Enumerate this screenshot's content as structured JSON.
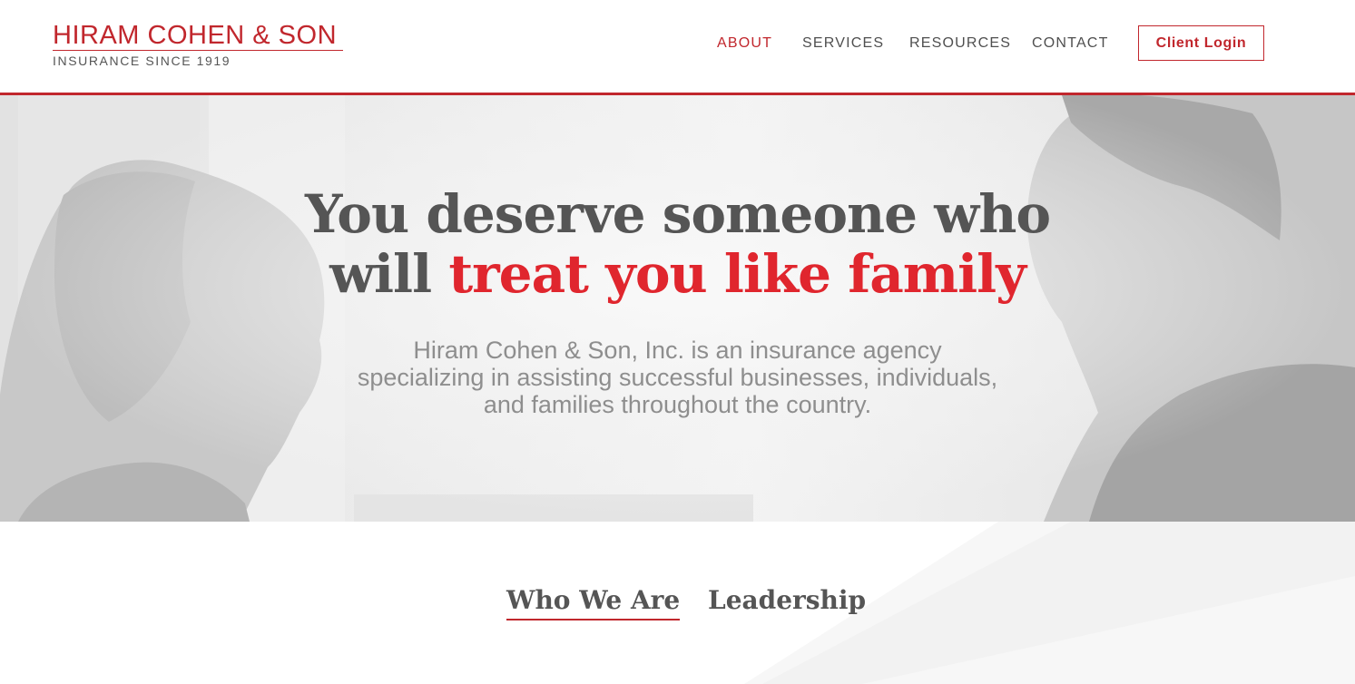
{
  "logo": {
    "title": "HIRAM COHEN & SON",
    "subtitle": "INSURANCE SINCE 1919"
  },
  "nav": {
    "items": [
      {
        "label": "ABOUT",
        "active": true
      },
      {
        "label": "SERVICES",
        "active": false
      },
      {
        "label": "RESOURCES",
        "active": false
      },
      {
        "label": "CONTACT",
        "active": false
      }
    ],
    "login_label": "Client Login"
  },
  "hero": {
    "headline_line1": "You deserve someone who",
    "headline_line2_plain": "will",
    "headline_line2_accent": "treat you like family",
    "subtext_line1": "Hiram Cohen & Son, Inc. is an insurance agency",
    "subtext_line2": "specializing in assisting successful businesses, individuals,",
    "subtext_line3": "and families throughout the country."
  },
  "tabs": [
    {
      "label": "Who We Are",
      "active": true
    },
    {
      "label": "Leadership",
      "active": false
    }
  ],
  "colors": {
    "brand_red": "#c1272d",
    "accent_red": "#e0262e",
    "text_gray": "#555555",
    "subtext_gray": "#8e8e8e"
  }
}
